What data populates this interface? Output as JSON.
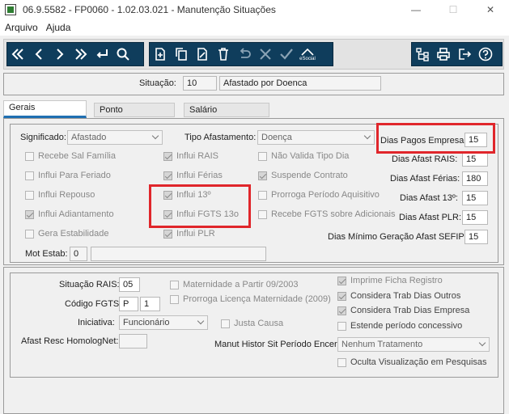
{
  "window": {
    "title": "06.9.5582 - FP0060 - 1.02.03.021 - Manutenção Situações",
    "controls": [
      "minimize-icon",
      "maximize-icon",
      "close-icon"
    ]
  },
  "menu": {
    "items": [
      "Arquivo",
      "Ajuda"
    ]
  },
  "toolbar": {
    "nav": [
      "first-icon",
      "prev-icon",
      "next-icon",
      "last-icon",
      "enter-icon",
      "search-icon"
    ],
    "edit": [
      "new-icon",
      "copy-icon",
      "edit-icon",
      "delete-icon",
      "undo-icon",
      "cancel-icon",
      "confirm-icon",
      "esocial-icon"
    ],
    "esocial_label": "eSocial",
    "right": [
      "tree-icon",
      "print-icon",
      "exit-icon",
      "help-icon"
    ]
  },
  "situacao": {
    "label": "Situação:",
    "code": "10",
    "description": "Afastado por Doenca"
  },
  "tabs": [
    "Gerais",
    "Ponto",
    "Salário"
  ],
  "gerais": {
    "significado_label": "Significado:",
    "significado_value": "Afastado",
    "tipo_afastamento_label": "Tipo Afastamento:",
    "tipo_afastamento_value": "Doença",
    "col1": [
      {
        "label": "Recebe Sal Família",
        "checked": false
      },
      {
        "label": "Influi Para Feriado",
        "checked": false
      },
      {
        "label": "Influi Repouso",
        "checked": false
      },
      {
        "label": "Influi Adiantamento",
        "checked": true
      },
      {
        "label": "Gera Estabilidade",
        "checked": false
      }
    ],
    "col2": [
      {
        "label": "Influi RAIS",
        "checked": true
      },
      {
        "label": "Influi Férias",
        "checked": true
      },
      {
        "label": "Influi 13º",
        "checked": true
      },
      {
        "label": "Influi FGTS 13o",
        "checked": true
      },
      {
        "label": "Influi PLR",
        "checked": true
      }
    ],
    "col3": [
      {
        "label": "Não Valida Tipo Dia",
        "checked": false
      },
      {
        "label": "Suspende Contrato",
        "checked": true
      },
      {
        "label": "Prorroga Período Aquisitivo",
        "checked": false
      },
      {
        "label": "Recebe FGTS sobre Adicionais",
        "checked": false
      }
    ],
    "dias": [
      {
        "label": "Dias Pagos Empresa:",
        "value": "15"
      },
      {
        "label": "Dias Afast RAIS:",
        "value": "15"
      },
      {
        "label": "Dias Afast Férias:",
        "value": "180"
      },
      {
        "label": "Dias Afast 13º:",
        "value": "15"
      },
      {
        "label": "Dias Afast PLR:",
        "value": "15"
      },
      {
        "label": "Dias Mínimo Geração Afast SEFIP:",
        "value": "15"
      }
    ],
    "mot_estab_label": "Mot Estab:",
    "mot_estab_code": "0",
    "mot_estab_desc": ""
  },
  "bottom": {
    "situacao_rais_label": "Situação RAIS:",
    "situacao_rais_value": "05",
    "codigo_fgts_label": "Código FGTS:",
    "codigo_fgts_value1": "P",
    "codigo_fgts_value2": "1",
    "iniciativa_label": "Iniciativa:",
    "iniciativa_value": "Funcionário",
    "afast_resc_label": "Afast Resc HomologNet:",
    "afast_resc_value": "",
    "mid_checks": [
      {
        "label": "Maternidade a Partir 09/2003",
        "checked": false
      },
      {
        "label": "Prorroga Licença Maternidade (2009)",
        "checked": false
      },
      {
        "label": "Justa Causa",
        "checked": false
      }
    ],
    "right_checks": [
      {
        "label": "Imprime Ficha Registro",
        "checked": true
      },
      {
        "label": "Considera Trab Dias Outros",
        "checked": true
      },
      {
        "label": "Considera Trab Dias Empresa",
        "checked": true
      },
      {
        "label": "Estende período concessivo",
        "checked": false
      }
    ],
    "manut_label": "Manut Histor Sit Período Encer:",
    "manut_value": "Nenhum Tratamento",
    "oculta": {
      "label": "Oculta Visualização em Pesquisas",
      "checked": false
    }
  }
}
